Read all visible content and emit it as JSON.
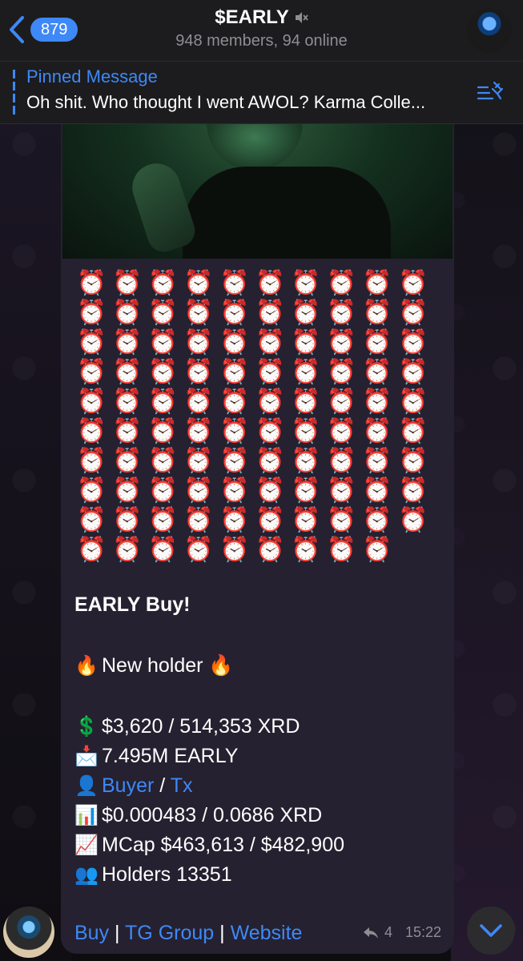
{
  "header": {
    "back_badge": "879",
    "title": "$EARLY",
    "subtitle": "948 members, 94 online"
  },
  "pinned": {
    "title": "Pinned Message",
    "text": "Oh shit. Who thought I went AWOL? Karma Colle..."
  },
  "message": {
    "clock_emoji": "⏰",
    "clock_rows": [
      10,
      10,
      10,
      10,
      10,
      10,
      10,
      10,
      10,
      9
    ],
    "headline": "EARLY Buy!",
    "new_holder": {
      "emoji_left": "🔥",
      "label": "New holder",
      "emoji_right": "🔥"
    },
    "lines": [
      {
        "emoji": "💲",
        "text": "$3,620 / 514,353 XRD"
      },
      {
        "emoji": "📩",
        "text": "7.495M EARLY"
      },
      {
        "emoji": "📊",
        "text": "$0.000483 / 0.0686 XRD"
      },
      {
        "emoji": "📈",
        "text": "MCap $463,613 / $482,900"
      },
      {
        "emoji": "👥",
        "text": "Holders 13351"
      }
    ],
    "buyer_line": {
      "emoji": "👤",
      "buyer_link": "Buyer",
      "separator": " / ",
      "tx_link": "Tx"
    },
    "footer_links": {
      "buy": "Buy",
      "sep1": " | ",
      "tg_group": "TG Group",
      "sep2": " | ",
      "website": "Website"
    },
    "reply_count": "4",
    "time": "15:22"
  },
  "colors": {
    "accent": "#3e88f7",
    "bubble": "#252130",
    "header_bg": "#1c1c1e",
    "muted_text": "#8e8e93"
  }
}
